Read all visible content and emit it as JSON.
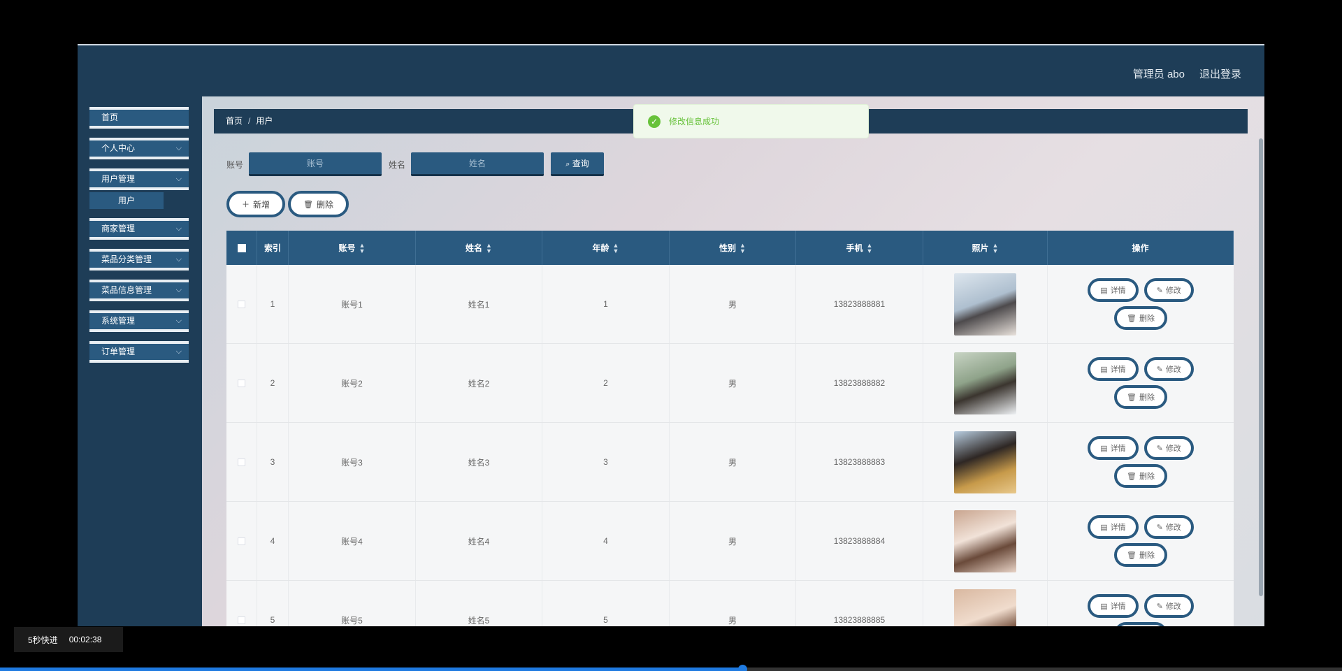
{
  "header": {
    "user_label": "管理员 abo",
    "logout_label": "退出登录"
  },
  "toast": {
    "message": "修改信息成功",
    "icon": "check-circle-icon",
    "color": "#67c23a"
  },
  "sidebar": {
    "items": [
      {
        "label": "首页",
        "has_chevron": false
      },
      {
        "label": "个人中心",
        "has_chevron": true
      },
      {
        "label": "用户管理",
        "has_chevron": true
      },
      {
        "label": "商家管理",
        "has_chevron": true
      },
      {
        "label": "菜品分类管理",
        "has_chevron": true
      },
      {
        "label": "菜品信息管理",
        "has_chevron": true
      },
      {
        "label": "系统管理",
        "has_chevron": true
      },
      {
        "label": "订单管理",
        "has_chevron": true
      }
    ],
    "subitem": "用户"
  },
  "breadcrumb": {
    "home": "首页",
    "separator": "/",
    "current": "用户"
  },
  "search": {
    "account_label": "账号",
    "account_placeholder": "账号",
    "name_label": "姓名",
    "name_placeholder": "姓名",
    "query_label": "查询"
  },
  "actions": {
    "add_label": "新增",
    "delete_label": "删除"
  },
  "table": {
    "headers": [
      "索引",
      "账号",
      "姓名",
      "年龄",
      "性别",
      "手机",
      "照片",
      "操作"
    ],
    "rows": [
      {
        "index": "1",
        "account": "账号1",
        "name": "姓名1",
        "age": "1",
        "gender": "男",
        "phone": "13823888881"
      },
      {
        "index": "2",
        "account": "账号2",
        "name": "姓名2",
        "age": "2",
        "gender": "男",
        "phone": "13823888882"
      },
      {
        "index": "3",
        "account": "账号3",
        "name": "姓名3",
        "age": "3",
        "gender": "男",
        "phone": "13823888883"
      },
      {
        "index": "4",
        "account": "账号4",
        "name": "姓名4",
        "age": "4",
        "gender": "男",
        "phone": "13823888884"
      },
      {
        "index": "5",
        "account": "账号5",
        "name": "姓名5",
        "age": "5",
        "gender": "男",
        "phone": "13823888885"
      }
    ],
    "row_actions": {
      "detail": "详情",
      "edit": "修改",
      "delete": "删除"
    }
  },
  "player": {
    "label": "5秒快进",
    "time": "00:02:38",
    "progress": 0.553
  },
  "colors": {
    "primary": "#2a5a80",
    "dark": "#1e3d57",
    "success": "#67c23a",
    "progress": "#1f7ae0"
  }
}
